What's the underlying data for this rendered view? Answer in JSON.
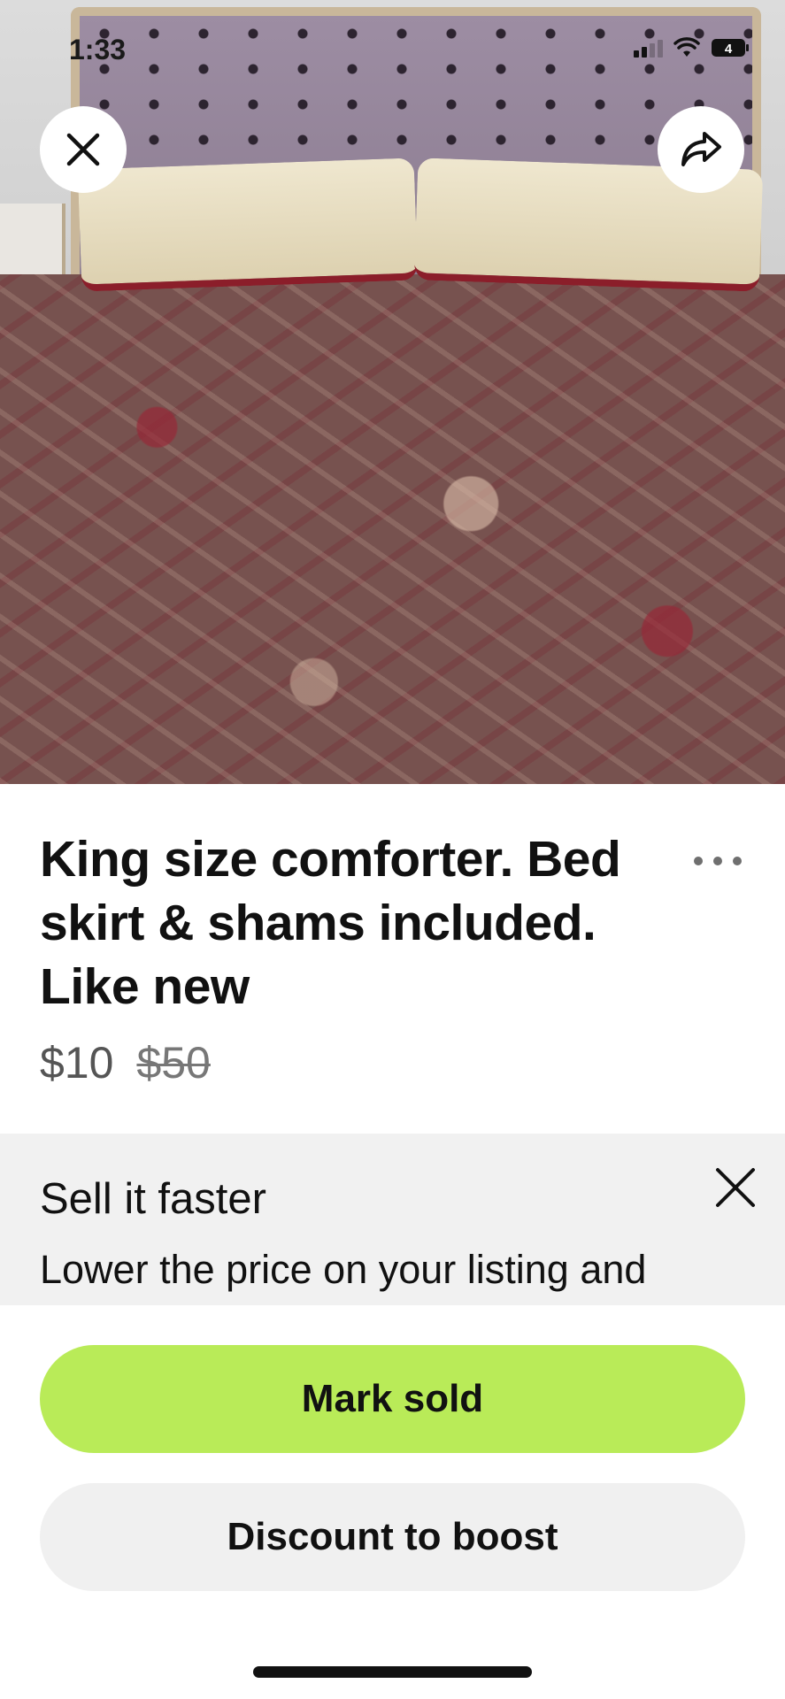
{
  "status_bar": {
    "time": "1:33",
    "battery": "4"
  },
  "listing": {
    "title": "King size comforter. Bed skirt & shams included. Like new",
    "price": "$10",
    "original_price": "$50"
  },
  "promo": {
    "title": "Sell it faster",
    "text": "Lower the price on your listing and"
  },
  "actions": {
    "mark_sold": "Mark sold",
    "discount": "Discount to boost"
  },
  "colors": {
    "accent": "#b9eb58",
    "secondary_button": "#f0f0f0",
    "promo_bg": "#f1f1f1"
  },
  "icons": [
    "close-icon",
    "share-icon",
    "more-icon",
    "dismiss-icon",
    "signal-icon",
    "wifi-icon",
    "battery-icon"
  ]
}
